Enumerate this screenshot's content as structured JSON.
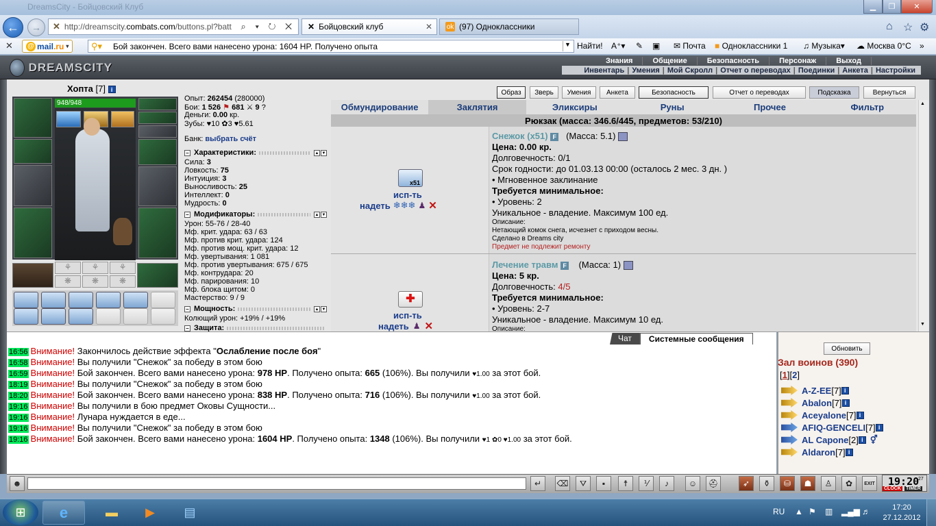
{
  "browser": {
    "title_blurred": "DreamsCity - Бойцовский Клуб",
    "url_prefix": "http://dreamscity.",
    "url_domain": "combats.com",
    "url_path": "/buttons.pl?batt",
    "url_icons": "⌕ ▾ ↻ ✕",
    "tabs": [
      {
        "label": "Бойцовский клуб",
        "icon": "X"
      },
      {
        "label": "(97) Одноклассники",
        "icon": "ok"
      }
    ],
    "nav_icons": [
      "home-icon",
      "star-icon",
      "gear-icon"
    ]
  },
  "toolbar": {
    "mail_label": "@mail.ru",
    "search_text": "Бой закончен. Всего вами нанесено урона: 1604 HP. Получено опыта",
    "search_button": "Найти!",
    "items": [
      "Почта",
      "Одноклассники 1",
      "Музыка",
      "Москва 0°C"
    ]
  },
  "game": {
    "logo": "DREAMSCITY",
    "top_menu": [
      "Знания",
      "Общение",
      "Безопасность",
      "Персонаж",
      "Выход"
    ],
    "sub_menu": [
      "Инвентарь",
      "Умения",
      "Мой Скролл",
      "Отчет о переводах",
      "Поединки",
      "Анкета",
      "Настройки"
    ],
    "char": {
      "name": "Хопта",
      "level": "[7]",
      "hp": "948/948",
      "exp_label": "Опыт:",
      "exp": "262454",
      "exp_next": "(280000)",
      "fights_label": "Бои:",
      "wins": "1 526",
      "losses": "681",
      "draws": "9",
      "money_label": "Деньги:",
      "money": "0.00",
      "money_unit": "кр.",
      "teeth_label": "Зубы:",
      "teeth": "10 ✿3 ♥5.61",
      "bank_label": "Банк:",
      "bank_link": "выбрать счёт"
    },
    "sections": {
      "stats_title": "Характеристики:",
      "mods_title": "Модификаторы:",
      "power_title": "Мощность:",
      "defense_title": "Защита:"
    },
    "stats": [
      {
        "label": "Сила:",
        "value": "3"
      },
      {
        "label": "Ловкость:",
        "value": "75"
      },
      {
        "label": "Интуиция:",
        "value": "3"
      },
      {
        "label": "Выносливость:",
        "value": "25"
      },
      {
        "label": "Интеллект:",
        "value": "0"
      },
      {
        "label": "Мудрость:",
        "value": "0"
      }
    ],
    "mods": [
      "Урон: 55-76 / 28-40",
      "Мф. крит. удара: 63 / 63",
      "Мф. против крит. удара: 124",
      "Мф. против мощ. крит. удара: 12",
      "Мф. увертывания: 1 081",
      "Мф. против увертывания: 675 / 675",
      "Мф. контрудара: 20",
      "Мф. парирования: 10",
      "Мф. блока щитом: 0",
      "Мастерство: 9 / 9"
    ],
    "power": [
      "Колющий урон: +19% / +19%"
    ],
    "buttons": [
      "Образ",
      "Зверь",
      "Умения",
      "Анкета",
      "Безопасность",
      "Отчет о переводах",
      "Подсказка",
      "Вернуться"
    ],
    "inv_tabs": [
      "Обмундирование",
      "Заклятия",
      "Эликсиры",
      "Руны",
      "Прочее",
      "Фильтр"
    ],
    "inv_tab_active": "Заклятия",
    "backpack": "Рюкзак (масса: 346.6/445, предметов: 53/210)",
    "items": [
      {
        "name": "Снежок (x51)",
        "count_badge": "x51",
        "mass": "(Масса: 5.1)",
        "price": "Цена: 0.00 кр.",
        "durability_label": "Долговечность:",
        "durability": "0/1",
        "expiry": "Срок годности: до 01.03.13 00:00 (осталось 2 мес. 3 дн. )",
        "instant": "• Мгновенное заклинание",
        "req_title": "Требуется минимальное:",
        "req_level": "• Уровень: 2",
        "unique": "Уникальное - владение. Максимум 100 ед.",
        "desc_title": "Описание:",
        "desc": "Нетающий комок снега, исчезнет с приходом весны.",
        "made": "Сделано в Dreams city",
        "norepair": "Предмет не подлежит ремонту",
        "use": "исп-ть",
        "wear": "надеть"
      },
      {
        "name": "Лечение травм",
        "mass": "(Масса: 1)",
        "price": "Цена: 5 кр.",
        "durability_label": "Долговечность:",
        "durability": "4/5",
        "req_title": "Требуется минимальное:",
        "req_level": "• Уровень: 2-7",
        "unique": "Уникальное - владение. Максимум 10 ед.",
        "desc_title": "Описание:",
        "use": "исп-ть",
        "wear": "надеть"
      }
    ]
  },
  "chat": {
    "tab_chat": "Чат",
    "tab_system": "Системные сообщения",
    "lines": [
      {
        "ts": "16:56",
        "warn": "Внимание!",
        "text": "Закончилось действие эффекта \"",
        "bold": "Ослабление после боя",
        "tail": "\""
      },
      {
        "ts": "16:58",
        "warn": "Внимание!",
        "text": "Вы получили \"Снежок\" за победу в этом бою"
      },
      {
        "ts": "16:59",
        "warn": "Внимание!",
        "text": "Бой закончен. Всего вами нанесено урона: ",
        "hp": "978 HP",
        "mid": ". Получено опыта: ",
        "exp": "665",
        "tail": " (106%). Вы получили ",
        "drop": "♥1.00",
        "end": " за этот бой."
      },
      {
        "ts": "18:19",
        "warn": "Внимание!",
        "text": "Вы получили \"Снежок\" за победу в этом бою"
      },
      {
        "ts": "18:20",
        "warn": "Внимание!",
        "text": "Бой закончен. Всего вами нанесено урона: ",
        "hp": "838 HP",
        "mid": ". Получено опыта: ",
        "exp": "716",
        "tail": " (106%). Вы получили ",
        "drop": "♥1.00",
        "end": " за этот бой."
      },
      {
        "ts": "19:16",
        "warn": "Внимание!",
        "text": "Вы получили в бою предмет Оковы Сущности..."
      },
      {
        "ts": "19:16",
        "warn": "Внимание!",
        "text": "Лунара нуждается в еде..."
      },
      {
        "ts": "19:16",
        "warn": "Внимание!",
        "text": "Вы получили \"Снежок\" за победу в этом бою"
      },
      {
        "ts": "19:16",
        "warn": "Внимание!",
        "text": "Бой закончен. Всего вами нанесено урона: ",
        "hp": "1604 HP",
        "mid": ". Получено опыта: ",
        "exp": "1348",
        "tail": " (106%). Вы получили ",
        "drop": "♥1 ✿0 ♥1.00",
        "end": " за этот бой."
      }
    ]
  },
  "online": {
    "refresh": "Обновить",
    "title": "Зал воинов (390)",
    "page_open": "[",
    "page1": "1",
    "page_mid": "][",
    "page2": "2",
    "page_close": "]",
    "players": [
      {
        "name": "A-Z-EE",
        "lvl": "[7]"
      },
      {
        "name": "Abalon",
        "lvl": "[7]"
      },
      {
        "name": "Aceyalone",
        "lvl": "[7]"
      },
      {
        "name": "AFIQ-GENCELI",
        "lvl": "[7]"
      },
      {
        "name": "AL Capone",
        "lvl": "[2]"
      },
      {
        "name": "Aldaron",
        "lvl": "[7]"
      }
    ]
  },
  "bottom": {
    "clock": "19:20",
    "clock_sec": "27",
    "clock_lab1": "CLOCK",
    "clock_lab2": "TIMER",
    "exit": "EXIT"
  },
  "taskbar": {
    "lang": "RU",
    "time": "17:20",
    "date": "27.12.2012"
  }
}
